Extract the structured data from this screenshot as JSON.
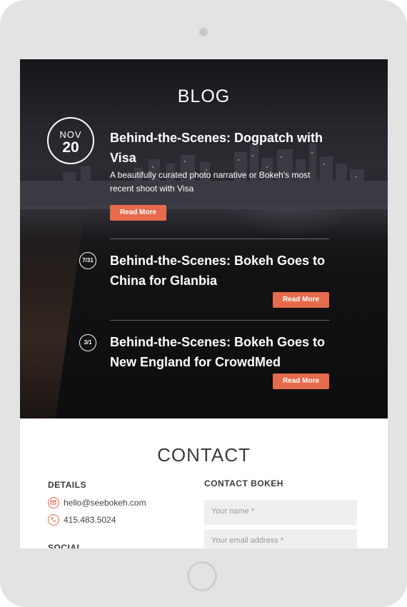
{
  "blog": {
    "title": "BLOG",
    "featured": {
      "month": "NOV",
      "day": "20",
      "title_line1": "Behind-the-Scenes: Dogpatch with",
      "title_line2": "Visa",
      "excerpt_line1": "A beautifully curated photo narrative or Bokeh's most",
      "excerpt_line2": "recent shoot with Visa",
      "button": "Read More"
    },
    "posts": [
      {
        "date": "7/31",
        "title_line1": "Behind-the-Scenes: Bokeh Goes to",
        "title_line2": "China for Glanbia",
        "button": "Read More"
      },
      {
        "date": "3/1",
        "title_line1": "Behind-the-Scenes: Bokeh Goes to",
        "title_line2": "New England for CrowdMed",
        "button": "Read More"
      }
    ]
  },
  "contact": {
    "title": "CONTACT",
    "details_heading": "DETAILS",
    "email": "hello@seebokeh.com",
    "phone": "415.483.5024",
    "social_heading": "SOCIAL",
    "form_heading": "CONTACT BOKEH",
    "name_placeholder": "Your name *",
    "email_placeholder": "Your email address *"
  },
  "colors": {
    "accent": "#e66a4c",
    "blog_bg": "#141416",
    "text_dark": "#3a3a3a"
  },
  "icons": {
    "email": "envelope-icon",
    "phone": "phone-icon"
  }
}
